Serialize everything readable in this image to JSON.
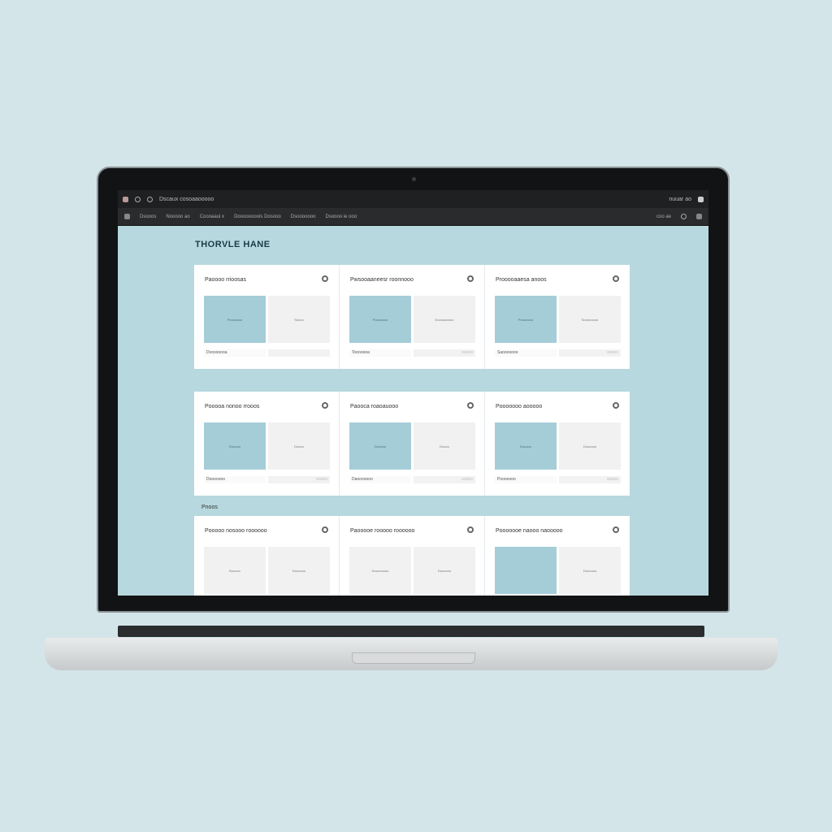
{
  "window": {
    "title": "Dscaux  cosoaaooooo",
    "right_label": "nuuar  ao"
  },
  "toolbar": {
    "items": [
      "Dsooos",
      "Nooooo  ao",
      "Coooaaui  x",
      "Doooooooois  Dosooo",
      "Dsooooooo",
      "Dsoooo ie ooo"
    ],
    "right_label": "coo ae"
  },
  "page": {
    "title": "THORVLE HANE"
  },
  "accent": "#a4cdd8",
  "rows": [
    {
      "label": "",
      "cards": [
        {
          "title": "Paoooo rrioosas",
          "left": {
            "style": "blue",
            "label": "Pooooooo"
          },
          "right": {
            "style": "gray",
            "label": "Soooo"
          },
          "footer_left": "Dvooooooa",
          "footer_right": ""
        },
        {
          "title": "Pwsooaaneesr roonnooo",
          "left": {
            "style": "blue",
            "label": "Pooooooo"
          },
          "right": {
            "style": "gray",
            "label": "Doooaooooo"
          },
          "footer_left": "Tooooooa",
          "footer_right": "ooooo"
        },
        {
          "title": "Prooooaaesa anoos",
          "left": {
            "style": "blue",
            "label": "Pooooooo"
          },
          "right": {
            "style": "gray",
            "label": "Soooooooo"
          },
          "footer_left": "Saooooooo",
          "footer_right": "ooooo"
        }
      ]
    },
    {
      "label": "",
      "cards": [
        {
          "title": "Pooooa nonoo rrooos",
          "left": {
            "style": "blue",
            "label": "Dooooo"
          },
          "right": {
            "style": "gray",
            "label": "Doooo"
          },
          "footer_left": "Dooooooo",
          "footer_right": "ooooo"
        },
        {
          "title": "Paooca roaoauooo",
          "left": {
            "style": "blue",
            "label": "Dooooo"
          },
          "right": {
            "style": "gray",
            "label": "Doooo"
          },
          "footer_left": "Daooooooo",
          "footer_right": "ooooo"
        },
        {
          "title": "Pooooooo aooooo",
          "left": {
            "style": "blue",
            "label": "Dooooo"
          },
          "right": {
            "style": "gray",
            "label": "Doooooo"
          },
          "footer_left": "Pooooooo",
          "footer_right": "ooooo"
        }
      ]
    },
    {
      "label": "Pnoos",
      "cards": [
        {
          "title": "Pooooo nosooo roooooo",
          "left": {
            "style": "gray",
            "label": "Booooo"
          },
          "right": {
            "style": "gray",
            "label": "Doooooo"
          },
          "footer_left": "",
          "footer_right": ""
        },
        {
          "title": "Paooooe rooooo roooooo",
          "left": {
            "style": "gray",
            "label": "Doooooooo"
          },
          "right": {
            "style": "gray",
            "label": "Doooooo"
          },
          "footer_left": "",
          "footer_right": ""
        },
        {
          "title": "Pooooooe naooo naooooo",
          "left": {
            "style": "blue",
            "label": ""
          },
          "right": {
            "style": "gray",
            "label": "Doooooo"
          },
          "footer_left": "",
          "footer_right": ""
        }
      ]
    }
  ]
}
